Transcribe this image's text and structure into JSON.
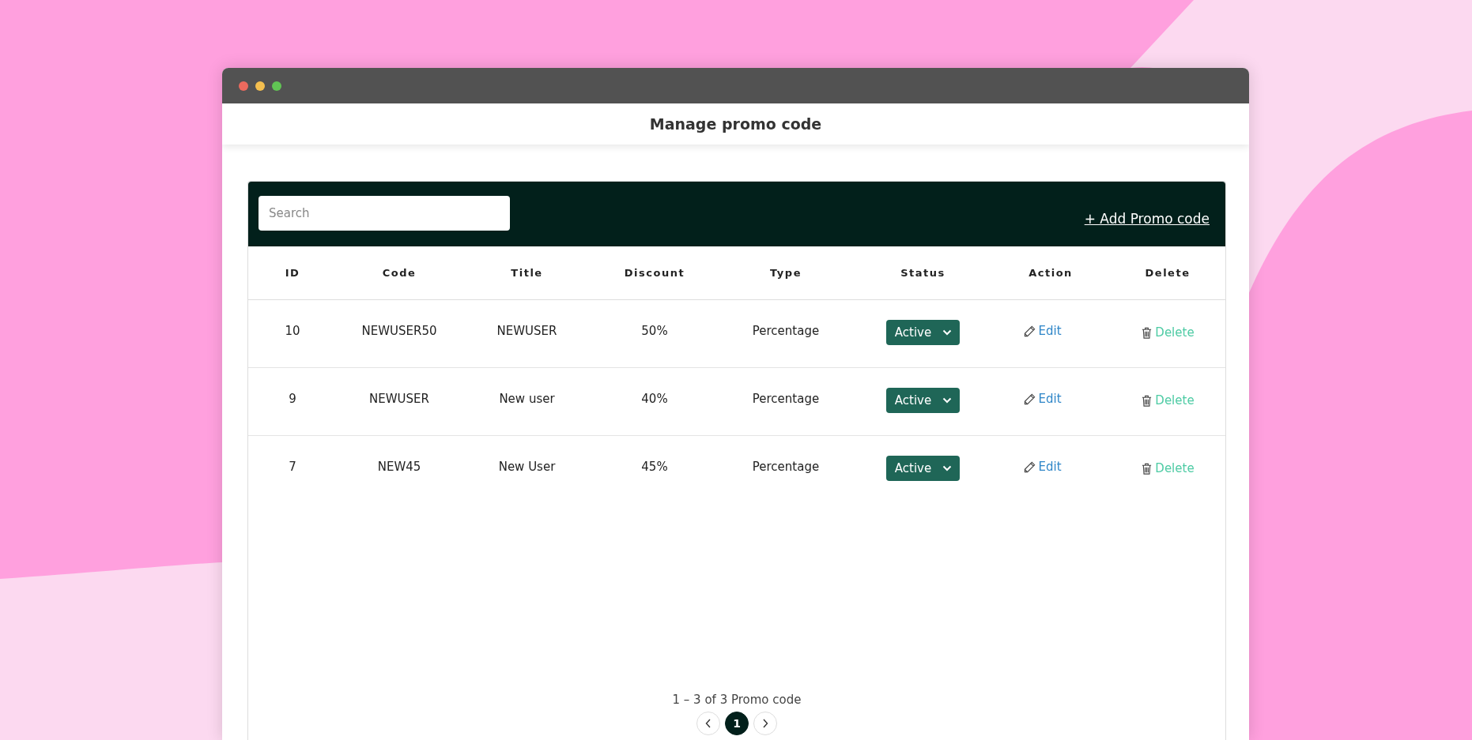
{
  "window": {
    "title": "Manage promo code"
  },
  "search": {
    "placeholder": "Search"
  },
  "add_link": "+ Add Promo code",
  "table": {
    "columns": [
      "ID",
      "Code",
      "Title",
      "Discount",
      "Type",
      "Status",
      "Action",
      "Delete"
    ],
    "rows": [
      {
        "id": "10",
        "code": "NEWUSER50",
        "title": "NEWUSER",
        "discount": "50%",
        "type": "Percentage",
        "status": "Active",
        "action": "Edit",
        "delete": "Delete"
      },
      {
        "id": "9",
        "code": "NEWUSER",
        "title": "New user",
        "discount": "40%",
        "type": "Percentage",
        "status": "Active",
        "action": "Edit",
        "delete": "Delete"
      },
      {
        "id": "7",
        "code": "NEW45",
        "title": "New User",
        "discount": "45%",
        "type": "Percentage",
        "status": "Active",
        "action": "Edit",
        "delete": "Delete"
      }
    ]
  },
  "pagination": {
    "summary": "1 – 3 of 3 Promo code",
    "pages": [
      {
        "label": "1",
        "selected": true
      }
    ]
  }
}
